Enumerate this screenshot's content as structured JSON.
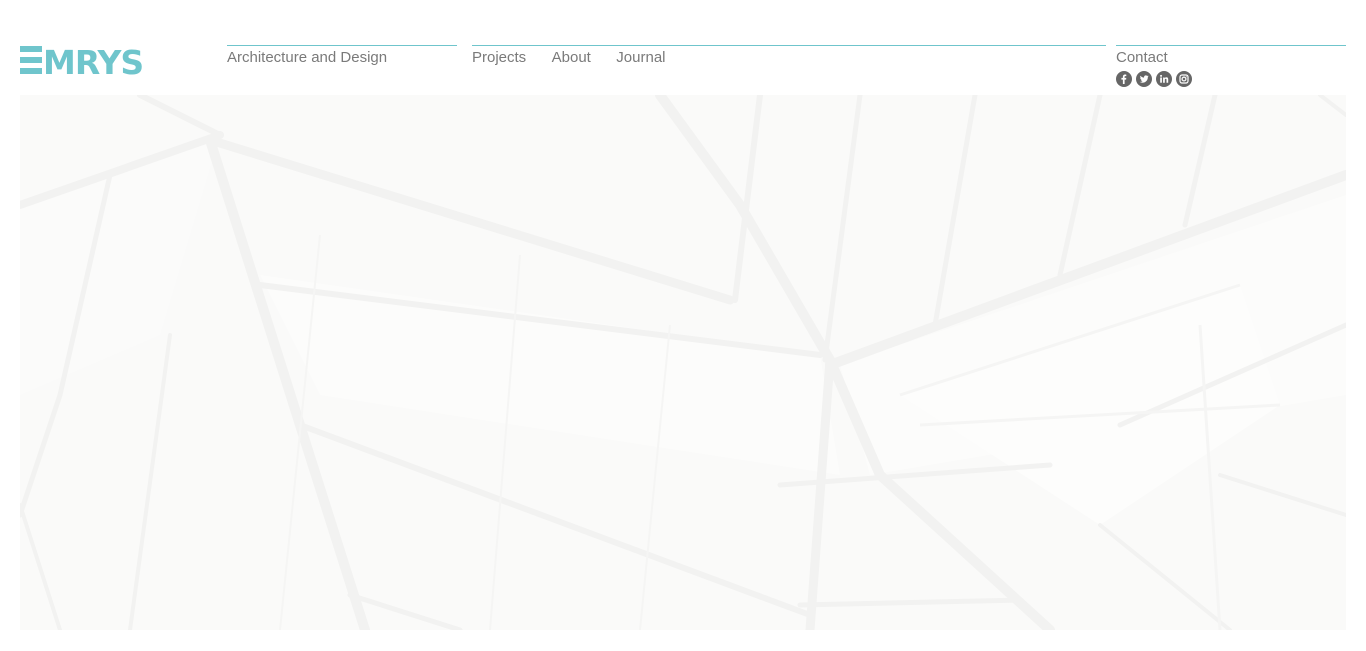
{
  "brand": {
    "logo_text": "EMRYS",
    "accent_color": "#6fc5cc"
  },
  "header": {
    "tagline": "Architecture and Design",
    "nav": [
      {
        "label": "Projects"
      },
      {
        "label": "About"
      },
      {
        "label": "Journal"
      }
    ],
    "contact_label": "Contact",
    "social": [
      {
        "icon": "facebook-icon"
      },
      {
        "icon": "twitter-icon"
      },
      {
        "icon": "linkedin-icon"
      },
      {
        "icon": "instagram-icon"
      }
    ]
  },
  "hero": {
    "image": "faint-architectural-roof-structure-photo"
  }
}
